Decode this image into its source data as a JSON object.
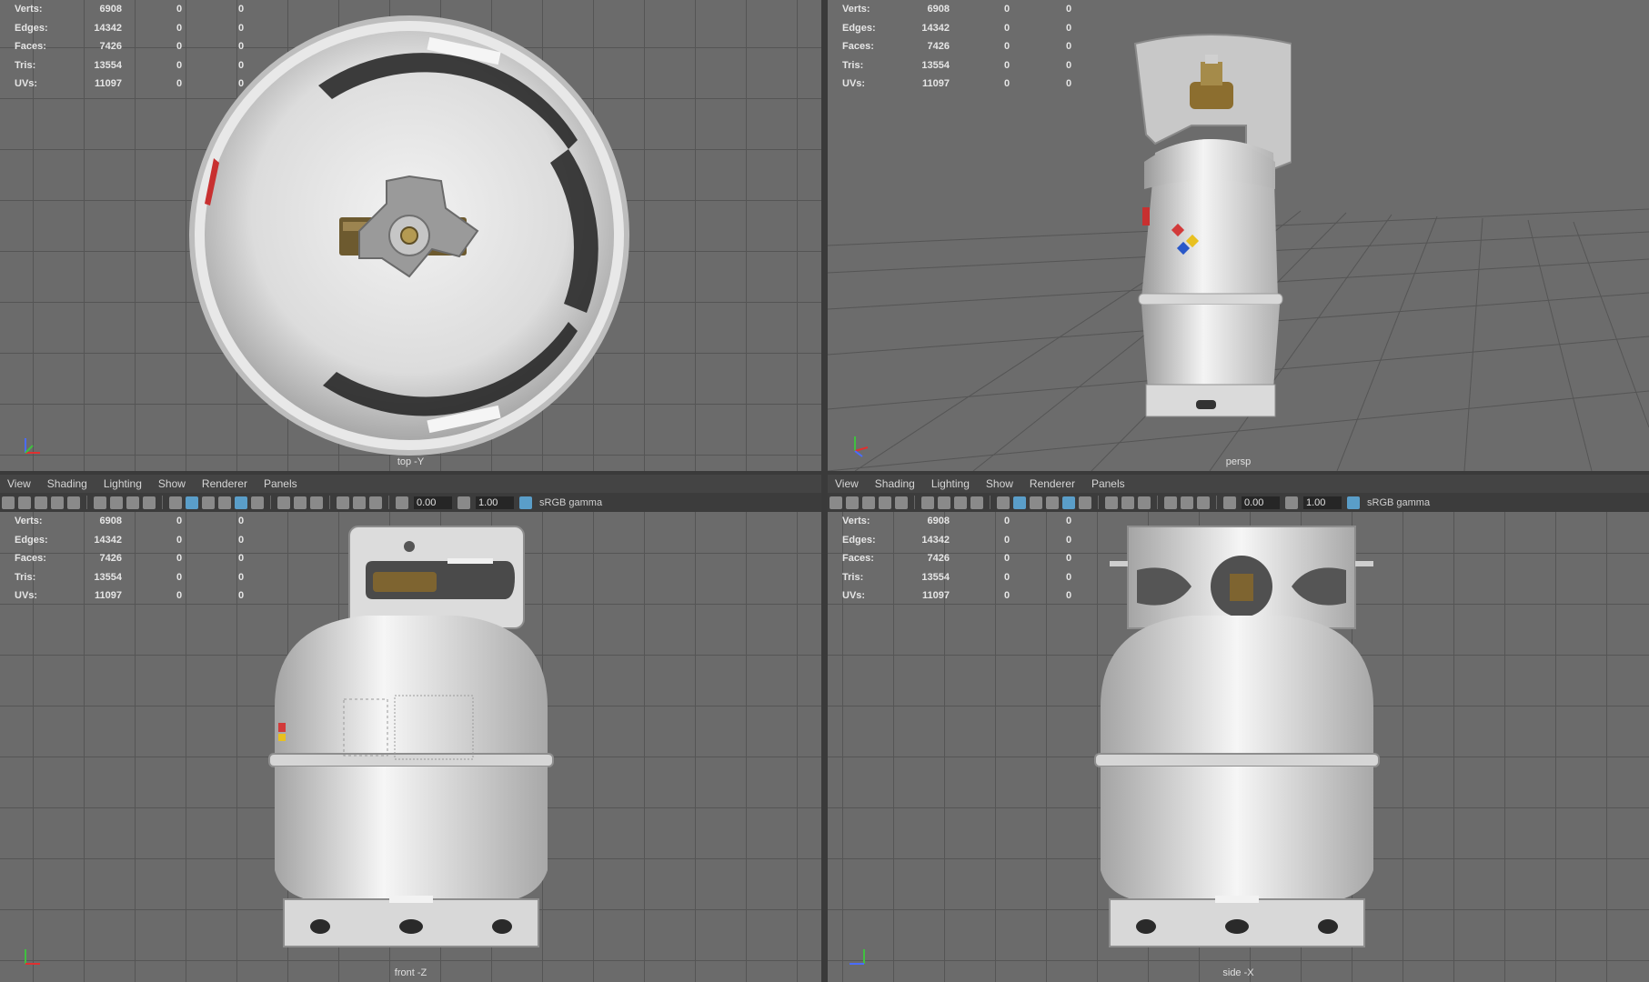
{
  "stats": {
    "rows": [
      {
        "label": "Verts:",
        "value": "6908",
        "a": "0",
        "b": "0"
      },
      {
        "label": "Edges:",
        "value": "14342",
        "a": "0",
        "b": "0"
      },
      {
        "label": "Faces:",
        "value": "7426",
        "a": "0",
        "b": "0"
      },
      {
        "label": "Tris:",
        "value": "13554",
        "a": "0",
        "b": "0"
      },
      {
        "label": "UVs:",
        "value": "11097",
        "a": "0",
        "b": "0"
      }
    ]
  },
  "viewports": {
    "top": {
      "camera": "top -Y"
    },
    "persp": {
      "camera": "persp"
    },
    "front": {
      "camera": "front -Z"
    },
    "side": {
      "camera": "side -X"
    }
  },
  "menu": [
    "View",
    "Shading",
    "Lighting",
    "Show",
    "Renderer",
    "Panels"
  ],
  "toolbar": {
    "exposure": "0.00",
    "gamma": "1.00",
    "color_space": "sRGB gamma"
  },
  "colors": {
    "viewport_bg": "#6b6b6b",
    "grid": "#555555",
    "accent": "#5a9ec9"
  }
}
